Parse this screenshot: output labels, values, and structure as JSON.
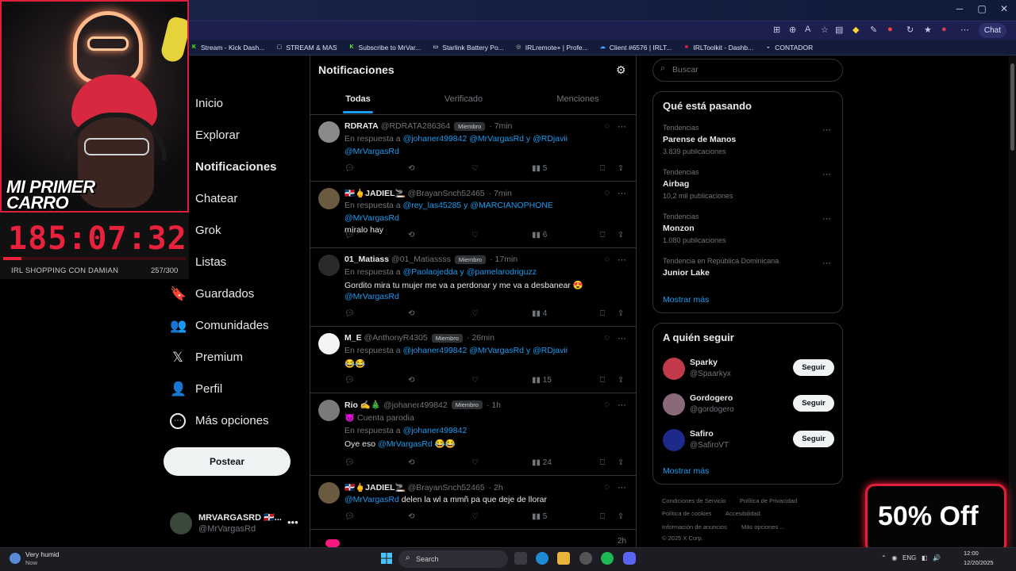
{
  "browser": {
    "chat_label": "Chat",
    "bookmarks": [
      {
        "label": "Stream - Kick Dash...",
        "color": "#53fc18",
        "glyph": "K"
      },
      {
        "label": "STREAM & MAS",
        "color": "#888888",
        "glyph": "▢"
      },
      {
        "label": "Subscribe to MrVar...",
        "color": "#53fc18",
        "glyph": "K"
      },
      {
        "label": "Starlink Battery Po...",
        "color": "#dddddd",
        "glyph": "▭"
      },
      {
        "label": "IRLremote+ | Profe...",
        "color": "#888888",
        "glyph": "◎"
      },
      {
        "label": "Client #6576 | IRLT...",
        "color": "#4aa3ff",
        "glyph": "☁"
      },
      {
        "label": "IRLToolkit - Dashb...",
        "color": "#e8213c",
        "glyph": "■"
      },
      {
        "label": "CONTADOR",
        "color": "#bbbbbb",
        "glyph": "◒"
      }
    ]
  },
  "overlay": {
    "cam_title": "MI PRIMER CARRO",
    "timer": "185:07:32",
    "goal_name": "IRL SHOPPING CON DAMIAN",
    "goal_count": "257/300",
    "goal_progress": 0.1,
    "promo": "50% Off"
  },
  "nav": {
    "items": [
      {
        "label": "Inicio",
        "icon": "home-icon"
      },
      {
        "label": "Explorar",
        "icon": "search-icon"
      },
      {
        "label": "Notificaciones",
        "icon": "bell-icon"
      },
      {
        "label": "Chatear",
        "icon": "mail-icon"
      },
      {
        "label": "Grok",
        "icon": "grok-icon"
      },
      {
        "label": "Listas",
        "icon": "list-icon"
      },
      {
        "label": "Guardados",
        "icon": "bookmark-icon"
      },
      {
        "label": "Comunidades",
        "icon": "people-icon"
      },
      {
        "label": "Premium",
        "icon": "x-logo-icon"
      },
      {
        "label": "Perfil",
        "icon": "user-icon"
      },
      {
        "label": "Más opciones",
        "icon": "more-circle-icon"
      }
    ],
    "post_button": "Postear",
    "account": {
      "name": "MRVARGASRD 🇩🇴...",
      "handle": "@MrVargasRd"
    }
  },
  "main": {
    "title": "Notificaciones",
    "tabs": [
      "Todas",
      "Verificado",
      "Menciones"
    ],
    "reply_prefix": "En respuesta a",
    "posts": [
      {
        "name": "RDRATA",
        "handle": "@RDRATA286364",
        "badge": "Miembro",
        "time": "· 7min",
        "reply_to": "@johaner499842 @MrVargasRd y @RDjavii",
        "text1": "@MrVargasRd",
        "text2": "",
        "views": "5",
        "avatar": "#8a8a8a"
      },
      {
        "name": "🇩🇴🖕JADIEL🚬",
        "handle": "@BrayanSnch52465",
        "badge": "",
        "time": "· 7min",
        "reply_to": "@rey_las45285 y @MARCIANOPHONE",
        "text1": "@MrVargasRd",
        "text2": "míralo hay",
        "views": "6",
        "avatar": "#6a5a40"
      },
      {
        "name": "01_Matiass",
        "handle": "@01_Matiassss",
        "badge": "Miembro",
        "time": "· 17min",
        "reply_to": "@Paolaojedda y @pamelarodriguzz",
        "text1": "Gordito mira tu mujer me va a perdonar y me va a desbanear 😍",
        "text2": "@MrVargasRd",
        "views": "4",
        "avatar": "#2a2a2a"
      },
      {
        "name": "M_E",
        "handle": "@AnthonyR4305",
        "badge": "Miembro",
        "time": "· 26min",
        "reply_to": "@johaner499842 @MrVargasRd y @RDjavii",
        "text1": "😂😂",
        "text2": "",
        "views": "15",
        "avatar": "#f4f4f4"
      },
      {
        "name": "Rio ✍️🎄",
        "handle": "@johaner499842",
        "badge": "Miembro",
        "time": "· 1h",
        "sub": "😈 Cuenta parodia",
        "reply_to": "@johaner499842",
        "text1": "Oye eso",
        "text1b": "@MrVargasRd 😂😂",
        "text2": "",
        "views": "24",
        "avatar": "#7a7a7a"
      },
      {
        "name": "🇩🇴🖕JADIEL🚬",
        "handle": "@BrayanSnch52465",
        "badge": "",
        "time": "· 2h",
        "reply_to": "",
        "text1": "@MrVargasRd",
        "text1b": "delen la wl a mmñ pa que deje de llorar",
        "text2": "",
        "views": "5",
        "avatar": "#6a5a40"
      }
    ],
    "next_time": "2h"
  },
  "right": {
    "search_placeholder": "Buscar",
    "trends_title": "Qué está pasando",
    "trends": [
      {
        "context": "Tendencias",
        "name": "Parense de Manos",
        "count": "3.839 publicaciones"
      },
      {
        "context": "Tendencias",
        "name": "Airbag",
        "count": "10,2 mil publicaciones"
      },
      {
        "context": "Tendencias",
        "name": "Monzon",
        "count": "1.080 publicaciones"
      },
      {
        "context": "Tendencia en República Dominicana",
        "name": "Junior Lake",
        "count": ""
      }
    ],
    "show_more": "Mostrar más",
    "who_title": "A quién seguir",
    "who": [
      {
        "name": "Sparky",
        "handle": "@Spaarkyx",
        "avatar": "#c23a4a"
      },
      {
        "name": "Gordogero",
        "handle": "@gordogero",
        "avatar": "#8a6a7a"
      },
      {
        "name": "Safiro",
        "handle": "@SafiroVT",
        "avatar": "#1e2a8a"
      }
    ],
    "follow_label": "Seguir",
    "footer": [
      "Condiciones de Servicio",
      "Política de Privacidad",
      "Política de cookies",
      "Accesibilidad",
      "Información de anuncios",
      "Más opciones ...",
      "© 2025 X Corp."
    ]
  },
  "taskbar": {
    "weather": "Very humid",
    "weather_sub": "Now",
    "search": "Search",
    "lang": "ENG",
    "time": "12:00",
    "date": "12/20/2025"
  }
}
